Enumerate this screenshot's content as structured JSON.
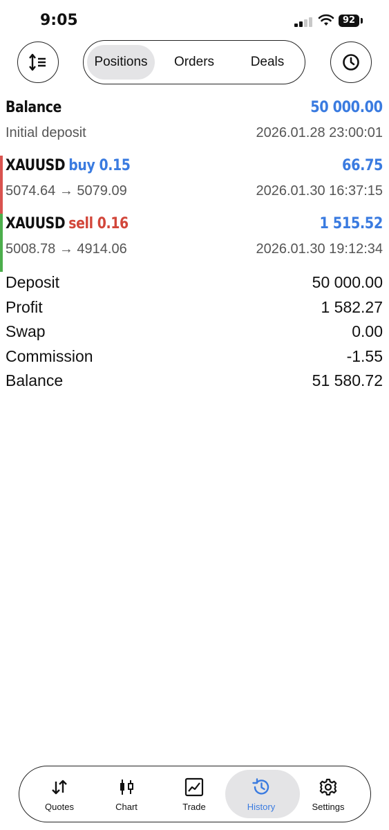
{
  "status_bar": {
    "time": "9:05",
    "battery": "92"
  },
  "toolbar": {
    "tabs": [
      {
        "label": "Positions",
        "active": true
      },
      {
        "label": "Orders",
        "active": false
      },
      {
        "label": "Deals",
        "active": false
      }
    ]
  },
  "balance_entry": {
    "title": "Balance",
    "amount": "50 000.00",
    "description": "Initial deposit",
    "datetime": "2026.01.28 23:00:01"
  },
  "deals": [
    {
      "symbol": "XAUUSD",
      "direction": "buy 0.15",
      "profit": "66.75",
      "prices": "5074.64 → 5079.09",
      "datetime": "2026.01.30 16:37:15",
      "side_color": "#d9534f"
    },
    {
      "symbol": "XAUUSD",
      "direction": "sell 0.16",
      "profit": "1 515.52",
      "prices": "5008.78 → 4914.06",
      "datetime": "2026.01.30 19:12:34",
      "side_color": "#4cae4c"
    }
  ],
  "summary": [
    {
      "label": "Deposit",
      "value": "50 000.00"
    },
    {
      "label": "Profit",
      "value": "1 582.27"
    },
    {
      "label": "Swap",
      "value": "0.00"
    },
    {
      "label": "Commission",
      "value": "-1.55"
    },
    {
      "label": "Balance",
      "value": "51 580.72"
    }
  ],
  "tab_bar": {
    "items": [
      {
        "label": "Quotes",
        "icon": "quotes-icon",
        "active": false
      },
      {
        "label": "Chart",
        "icon": "candlestick-chart-icon",
        "active": false
      },
      {
        "label": "Trade",
        "icon": "trade-chart-icon",
        "active": false
      },
      {
        "label": "History",
        "icon": "history-icon",
        "active": true
      },
      {
        "label": "Settings",
        "icon": "gear-icon",
        "active": false
      }
    ]
  },
  "colors": {
    "accent_blue": "#3a7be0",
    "sell_red": "#d2463a",
    "buy_bar_red": "#d9534f",
    "sell_bar_green": "#4cae4c",
    "active_pill": "#e4e4e6"
  }
}
